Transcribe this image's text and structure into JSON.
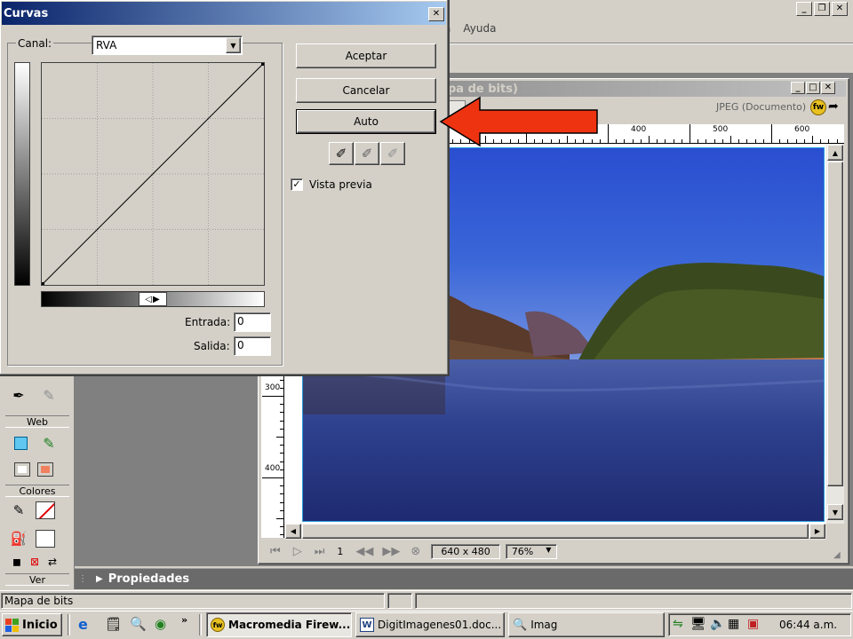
{
  "menu": {
    "items": [
      "a",
      "Ayuda"
    ]
  },
  "main_window": {
    "caption_buttons": [
      "_",
      "□",
      "×"
    ]
  },
  "doc_window": {
    "title_partial": "pa de bits)",
    "format_label": "JPEG (Documento)",
    "ruler_top": [
      "00",
      "400",
      "500",
      "600"
    ],
    "ruler_left": [
      "300",
      "400"
    ],
    "status": {
      "page": "1",
      "size": "640 x 480",
      "zoom": "76%"
    }
  },
  "curves_dialog": {
    "title": "Curvas",
    "canal_label": "Canal:",
    "canal_value": "RVA",
    "buttons": {
      "ok": "Aceptar",
      "cancel": "Cancelar",
      "auto": "Auto"
    },
    "preview_label": "Vista previa",
    "preview_checked": true,
    "entrada_label": "Entrada:",
    "entrada_value": "0",
    "salida_label": "Salida:",
    "salida_value": "0"
  },
  "toolbox": {
    "sections": [
      "Web",
      "Colores",
      "Ver"
    ]
  },
  "properties_panel": {
    "title": "Propiedades"
  },
  "status_bar": {
    "text": "Mapa de bits"
  },
  "taskbar": {
    "start": "Inicio",
    "buttons": [
      "Macromedia Firew...",
      "DigitImagenes01.doc...",
      "Imag"
    ],
    "clock": "06:44 a.m."
  },
  "colors": {
    "arrow": "#ee3311",
    "title_active": "#0a246a",
    "sky": "#3a66d8",
    "water": "#283a8a"
  }
}
